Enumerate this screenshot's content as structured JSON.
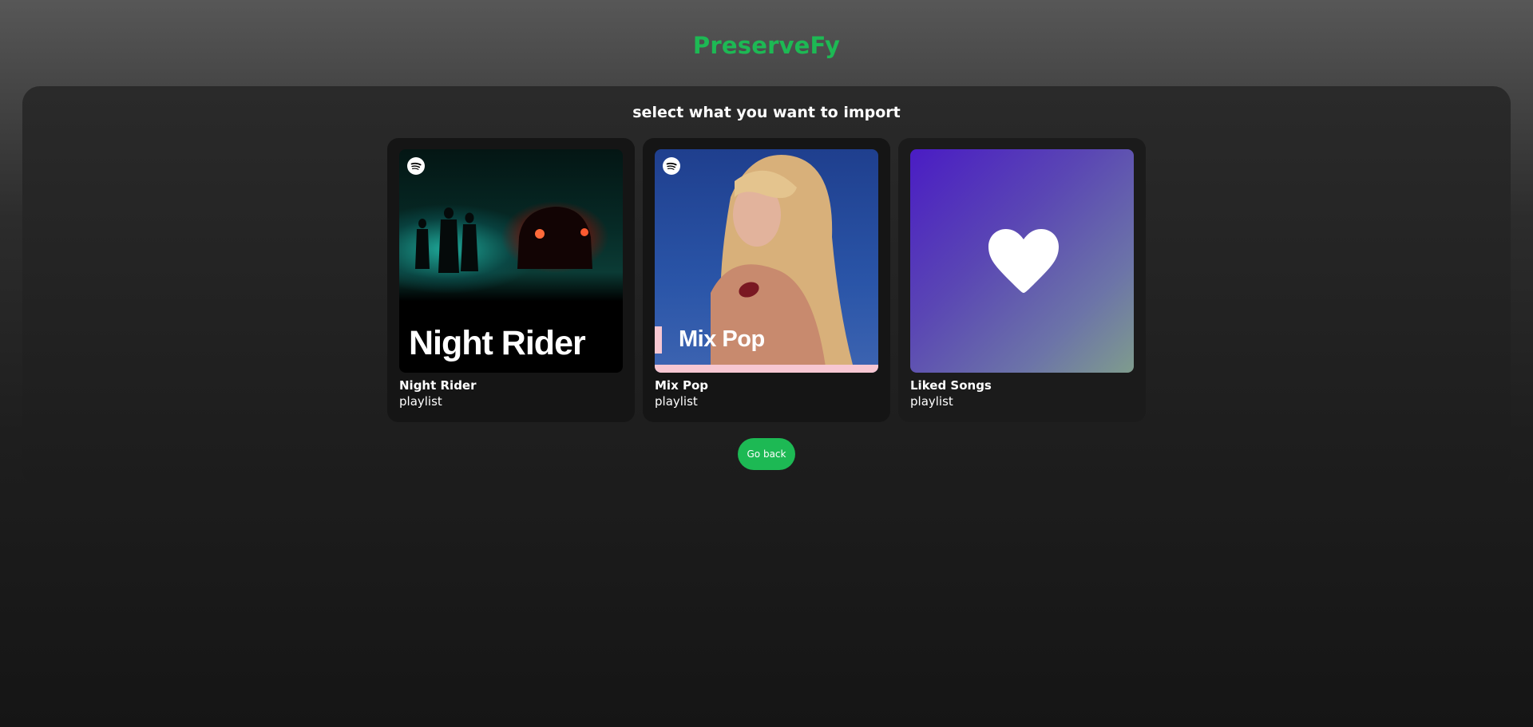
{
  "app": {
    "title": "PreserveFy",
    "accent_color": "#1db954"
  },
  "panel": {
    "subtitle": "select what you want to import"
  },
  "playlists": [
    {
      "name": "Night Rider",
      "type": "playlist",
      "cover_text": "Night Rider",
      "icon": "spotify-logo-icon"
    },
    {
      "name": "Mix Pop",
      "type": "playlist",
      "cover_text": "Mix Pop",
      "icon": "spotify-logo-icon"
    },
    {
      "name": "Liked Songs",
      "type": "playlist",
      "icon": "heart-icon"
    }
  ],
  "actions": {
    "go_back_label": "Go back"
  }
}
